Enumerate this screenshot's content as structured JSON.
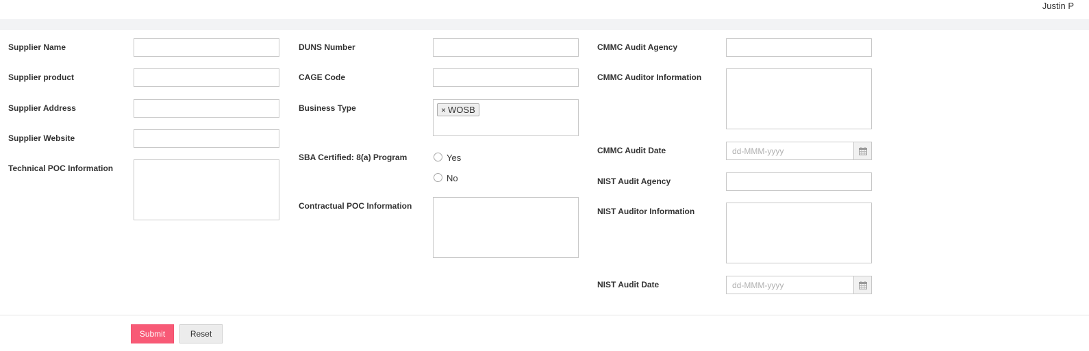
{
  "header": {
    "user_name": "Justin P"
  },
  "column1": {
    "supplier_name": {
      "label": "Supplier Name",
      "value": "",
      "placeholder": ""
    },
    "supplier_product": {
      "label": "Supplier product",
      "value": "",
      "placeholder": ""
    },
    "supplier_address": {
      "label": "Supplier Address",
      "value": "",
      "placeholder": ""
    },
    "supplier_website": {
      "label": "Supplier Website",
      "value": "",
      "placeholder": ""
    },
    "technical_poc": {
      "label": "Technical POC Information",
      "value": ""
    }
  },
  "column2": {
    "duns_number": {
      "label": "DUNS Number",
      "value": "",
      "placeholder": ""
    },
    "cage_code": {
      "label": "CAGE Code",
      "value": "",
      "placeholder": ""
    },
    "business_type": {
      "label": "Business Type",
      "tags": [
        {
          "remove": "×",
          "text": "WOSB"
        }
      ]
    },
    "sba_certified": {
      "label": "SBA Certified: 8(a) Program",
      "options": [
        {
          "label": "Yes",
          "checked": false
        },
        {
          "label": "No",
          "checked": false
        }
      ]
    },
    "contractual_poc": {
      "label": "Contractual POC Information",
      "value": ""
    }
  },
  "column3": {
    "cmmc_audit_agency": {
      "label": "CMMC Audit Agency",
      "value": "",
      "placeholder": ""
    },
    "cmmc_auditor_info": {
      "label": "CMMC Auditor Information",
      "value": ""
    },
    "cmmc_audit_date": {
      "label": "CMMC Audit Date",
      "value": "",
      "placeholder": "dd-MMM-yyyy",
      "button_icon": "calendar-icon"
    },
    "nist_audit_agency": {
      "label": "NIST Audit Agency",
      "value": "",
      "placeholder": ""
    },
    "nist_auditor_info": {
      "label": "NIST Auditor Information",
      "value": ""
    },
    "nist_audit_date": {
      "label": "NIST Audit Date",
      "value": "",
      "placeholder": "dd-MMM-yyyy",
      "button_icon": "calendar-icon"
    }
  },
  "actions": {
    "submit": "Submit",
    "reset": "Reset"
  },
  "colors": {
    "submit_bg": "#f85a76",
    "strip_bg": "#f2f3f5",
    "border": "#c8c8c8"
  }
}
